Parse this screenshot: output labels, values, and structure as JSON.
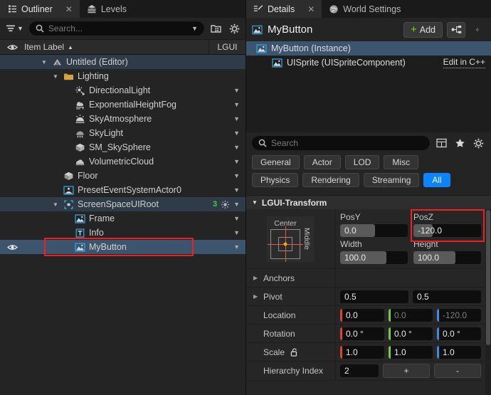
{
  "outliner": {
    "tabs": [
      {
        "label": "Outliner",
        "icon": "outliner-icon",
        "active": true,
        "closable": true
      },
      {
        "label": "Levels",
        "icon": "levels-icon",
        "active": false,
        "closable": false
      }
    ],
    "search_placeholder": "Search...",
    "columns": {
      "item_label": "Item Label",
      "sort_arrow": "▲",
      "lgui": "LGUI"
    },
    "items": [
      {
        "label": "Untitled (Editor)",
        "indent": 1,
        "twisty": "down",
        "icon": "world-icon",
        "highlight": true
      },
      {
        "label": "Lighting",
        "indent": 2,
        "twisty": "down",
        "icon": "folder-icon"
      },
      {
        "label": "DirectionalLight",
        "indent": 3,
        "twisty": "none",
        "icon": "directional-light-icon",
        "caret": true
      },
      {
        "label": "ExponentialHeightFog",
        "indent": 3,
        "twisty": "none",
        "icon": "fog-icon",
        "caret": true
      },
      {
        "label": "SkyAtmosphere",
        "indent": 3,
        "twisty": "none",
        "icon": "sky-atmosphere-icon",
        "caret": true
      },
      {
        "label": "SkyLight",
        "indent": 3,
        "twisty": "none",
        "icon": "sky-light-icon",
        "caret": true
      },
      {
        "label": "SM_SkySphere",
        "indent": 3,
        "twisty": "none",
        "icon": "static-mesh-icon",
        "caret": true
      },
      {
        "label": "VolumetricCloud",
        "indent": 3,
        "twisty": "none",
        "icon": "cloud-icon",
        "caret": true
      },
      {
        "label": "Floor",
        "indent": 2,
        "twisty": "none",
        "icon": "static-mesh-icon",
        "caret": true
      },
      {
        "label": "PresetEventSystemActor0",
        "indent": 2,
        "twisty": "none",
        "icon": "lgui-actor-icon",
        "caret": true
      },
      {
        "label": "ScreenSpaceUIRoot",
        "indent": 2,
        "twisty": "down",
        "icon": "lgui-canvas-icon",
        "caret": true,
        "highlight": true,
        "badge": "3",
        "badge_icon": "sun-icon"
      },
      {
        "label": "Frame",
        "indent": 3,
        "twisty": "none",
        "icon": "lgui-sprite-icon",
        "caret": true
      },
      {
        "label": "Info",
        "indent": 3,
        "twisty": "none",
        "icon": "lgui-text-icon",
        "caret": true
      },
      {
        "label": "MyButton",
        "indent": 3,
        "twisty": "none",
        "icon": "lgui-sprite-icon",
        "caret": true,
        "selected": true,
        "eye": true,
        "annotated": true
      }
    ]
  },
  "details": {
    "tabs": [
      {
        "label": "Details",
        "icon": "details-icon",
        "active": true,
        "closable": true
      },
      {
        "label": "World Settings",
        "icon": "globe-icon",
        "active": false,
        "closable": false
      }
    ],
    "header": {
      "title": "MyButton",
      "icon": "lgui-sprite-icon",
      "add_label": "Add",
      "blueprint_icon": "blueprint-icon",
      "lock_icon": "unlock-icon"
    },
    "components": [
      {
        "label": "MyButton (Instance)",
        "icon": "lgui-sprite-icon",
        "selected": true,
        "indent": 0
      },
      {
        "label": "UISprite (UISpriteComponent)",
        "icon": "lgui-sprite-icon",
        "selected": false,
        "indent": 1,
        "action": "Edit in C++"
      }
    ],
    "search_placeholder": "Search",
    "search_icons": [
      "table-view-icon",
      "favorite-star-icon",
      "settings-gear-icon"
    ],
    "filters_row1": [
      {
        "label": "General",
        "active": false
      },
      {
        "label": "Actor",
        "active": false
      },
      {
        "label": "LOD",
        "active": false
      },
      {
        "label": "Misc",
        "active": false
      }
    ],
    "filters_row2": [
      {
        "label": "Physics",
        "active": false
      },
      {
        "label": "Rendering",
        "active": false
      },
      {
        "label": "Streaming",
        "active": false
      },
      {
        "label": "All",
        "active": true
      }
    ],
    "section": {
      "title": "LGUI-Transform",
      "expanded": true
    },
    "anchor": {
      "horizontal": "Center",
      "vertical": "Middle"
    },
    "transform_fields": [
      {
        "label": "PosY",
        "value": "0.0",
        "fill": 52,
        "annotated": false
      },
      {
        "label": "PosZ",
        "value": "-120.0",
        "fill": 28,
        "annotated": true
      },
      {
        "label": "Width",
        "value": "100.0",
        "fill": 68,
        "annotated": false
      },
      {
        "label": "Height",
        "value": "100.0",
        "fill": 62,
        "annotated": false
      }
    ],
    "rows": [
      {
        "name": "Anchors",
        "expandable": true,
        "values": []
      },
      {
        "name": "Pivot",
        "expandable": true,
        "values": [
          {
            "value": "0.5",
            "axis": "none"
          },
          {
            "value": "0.5",
            "axis": "none"
          }
        ]
      },
      {
        "name": "Location",
        "expandable": false,
        "values": [
          {
            "value": "0.0",
            "axis": "x"
          },
          {
            "value": "0.0",
            "axis": "y",
            "dim": true
          },
          {
            "value": "-120.0",
            "axis": "z",
            "dim": true
          }
        ]
      },
      {
        "name": "Rotation",
        "expandable": false,
        "values": [
          {
            "value": "0.0 °",
            "axis": "x"
          },
          {
            "value": "0.0 °",
            "axis": "y"
          },
          {
            "value": "0.0 °",
            "axis": "z"
          }
        ]
      },
      {
        "name": "Scale",
        "expandable": false,
        "icon": "unlock-icon",
        "values": [
          {
            "value": "1.0",
            "axis": "x"
          },
          {
            "value": "1.0",
            "axis": "y"
          },
          {
            "value": "1.0",
            "axis": "z"
          }
        ]
      },
      {
        "name": "Hierarchy Index",
        "expandable": false,
        "values": [
          {
            "value": "2",
            "axis": "none"
          }
        ],
        "buttons": [
          "+",
          "-"
        ]
      }
    ]
  },
  "colors": {
    "accent_blue": "#0a84ff",
    "selection_blue": "#3c546e",
    "annotation_red": "#f02020",
    "lgui_icon": "#2ea3e0",
    "axis_x": "#e0412f",
    "axis_y": "#7ac943",
    "axis_z": "#3b8ce0",
    "badge_green": "#3bd43b",
    "plus_green": "#7ed321"
  }
}
